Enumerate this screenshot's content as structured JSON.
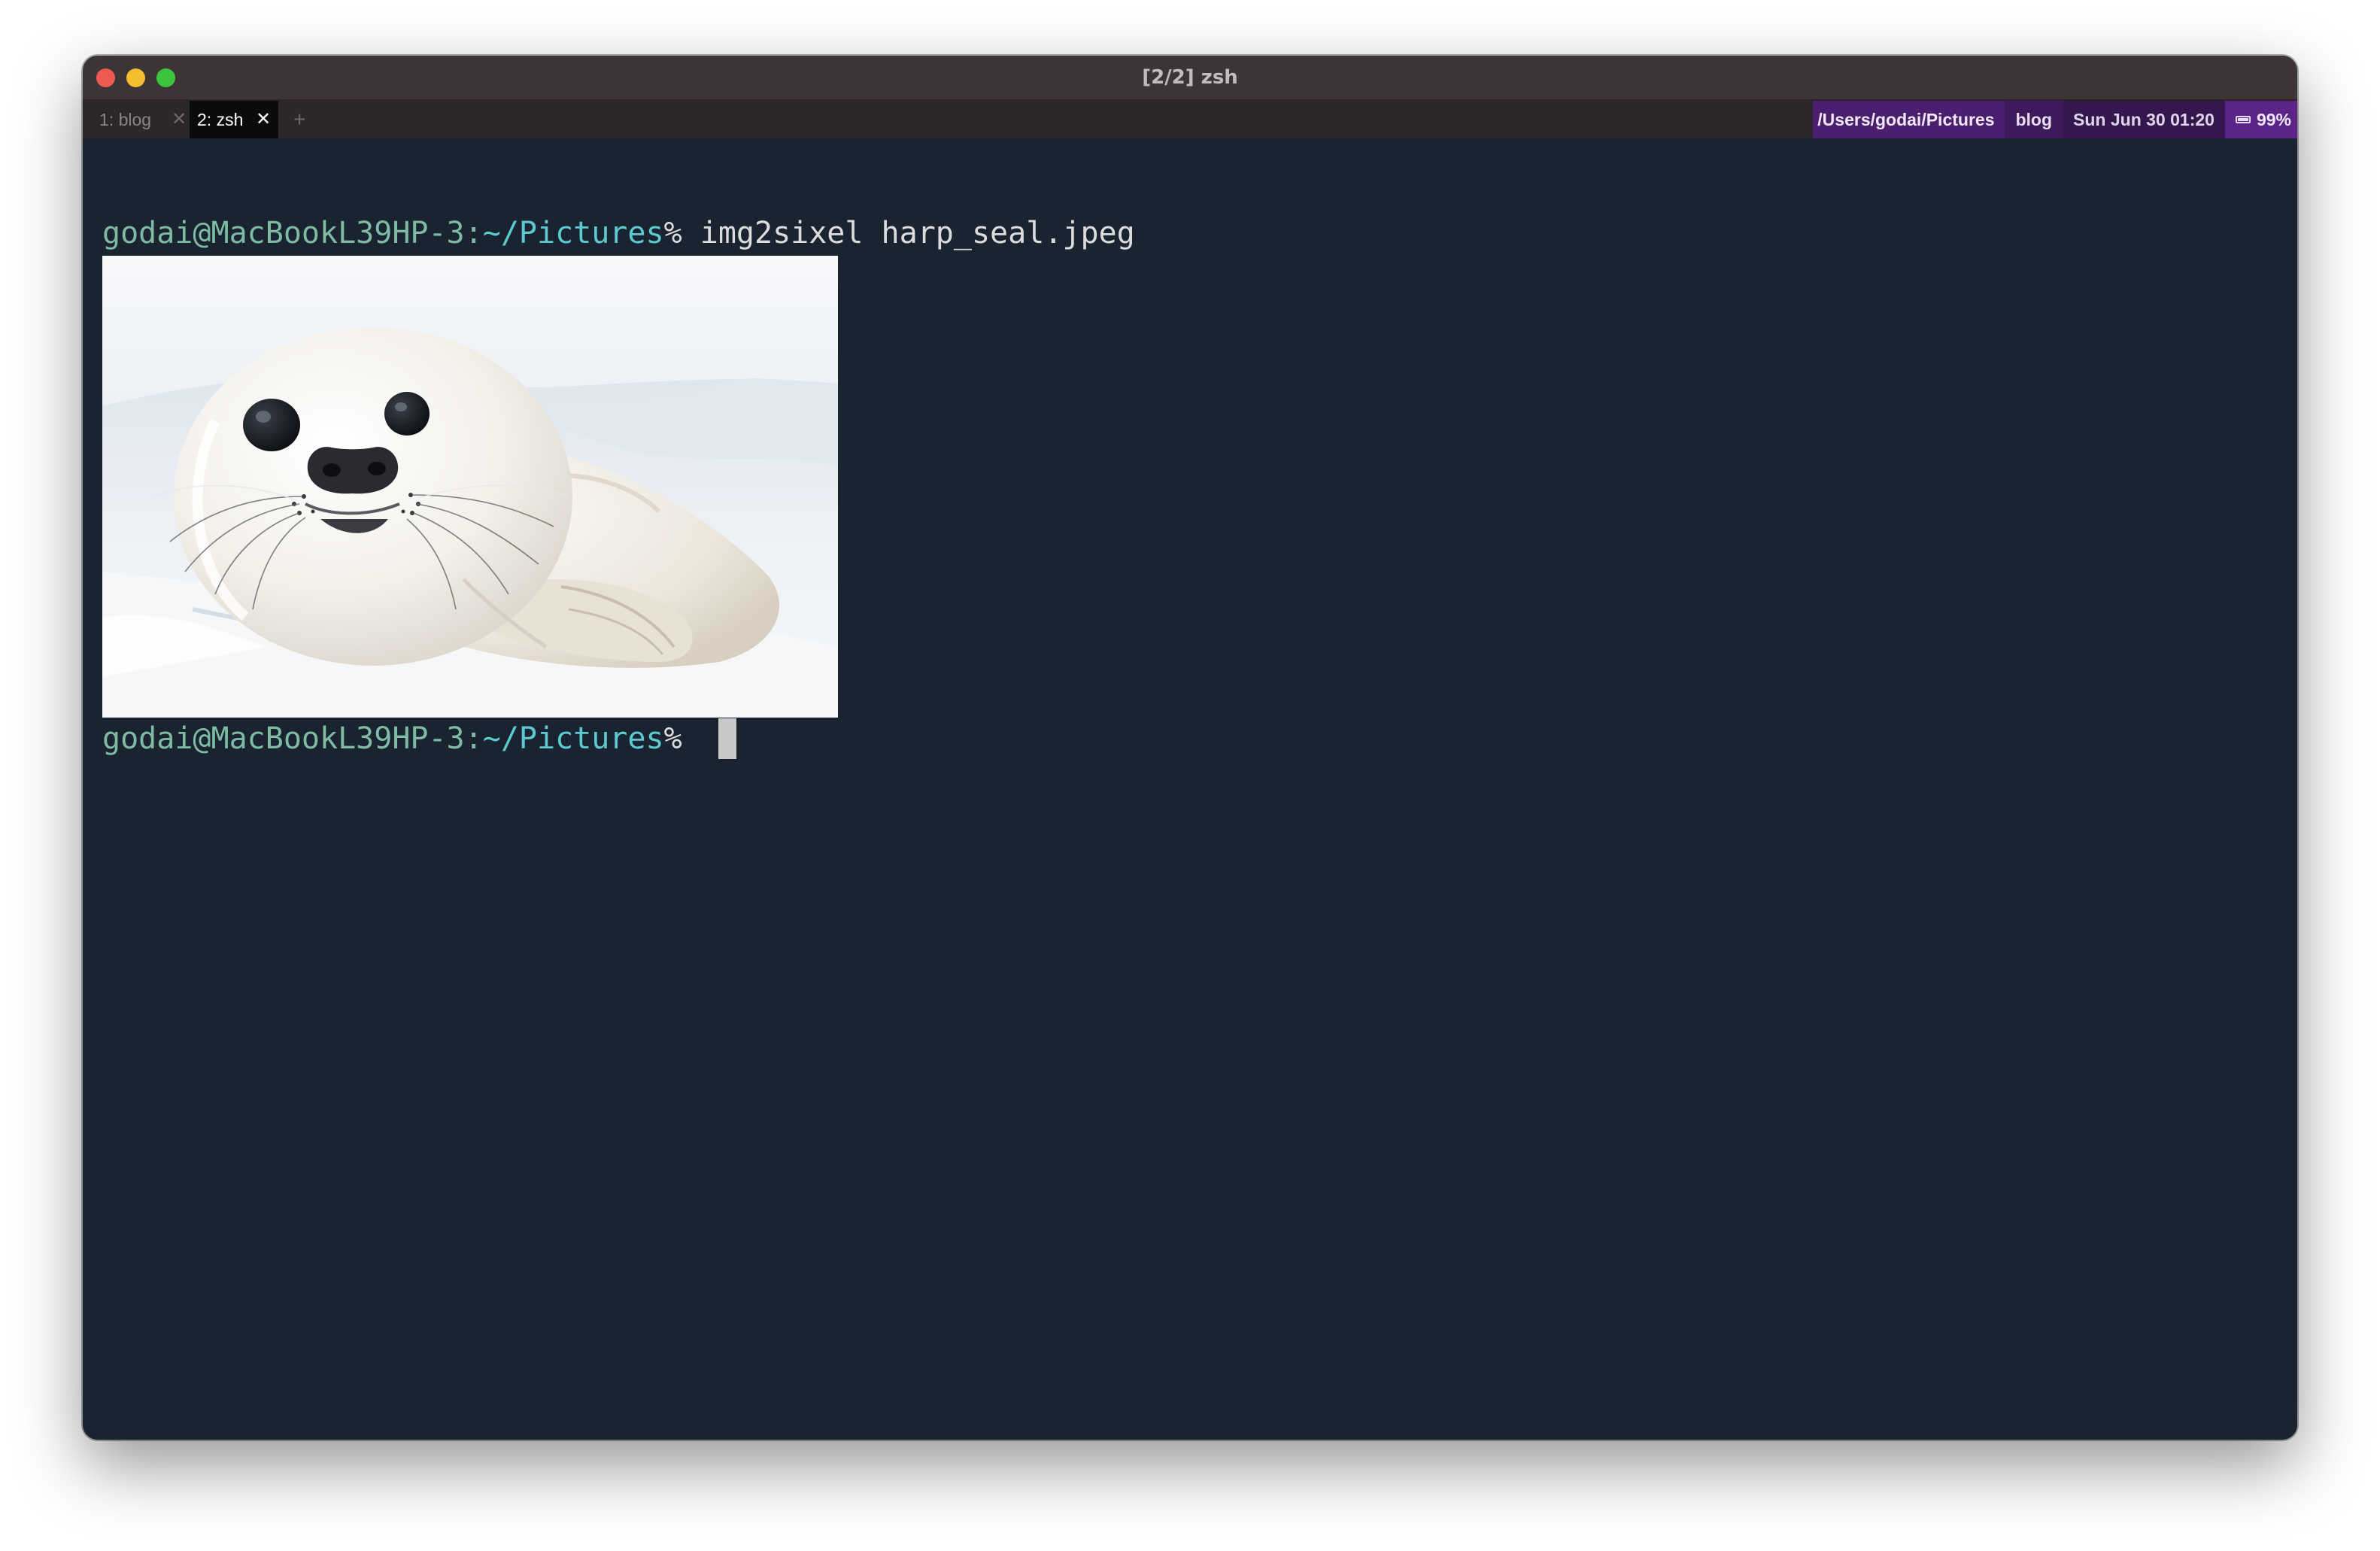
{
  "window": {
    "title": "[2/2] zsh"
  },
  "tabs": [
    {
      "label": "1: blog",
      "close": "✕"
    },
    {
      "label": "2: zsh",
      "close": "✕"
    }
  ],
  "new_tab": "+",
  "status_bar": {
    "path": "/Users/godai/Pictures",
    "session": "blog",
    "datetime": "Sun Jun 30 01:20",
    "battery": "99%"
  },
  "terminal": {
    "lines": [
      {
        "userhost": "godai@MacBookL39HP-3:",
        "cwd": "~/Pictures",
        "sigil": "% ",
        "command": "img2sixel harp_seal.jpeg"
      },
      {
        "userhost": "godai@MacBookL39HP-3:",
        "cwd": "~/Pictures",
        "sigil": "% ",
        "command": ""
      }
    ]
  },
  "icons": {
    "close": "close-icon",
    "new_tab": "plus-icon",
    "battery": "battery-icon"
  },
  "colors": {
    "terminal_bg": "#1a2330",
    "prompt_userhost": "#7dbba3",
    "prompt_cwd": "#5ccad0",
    "status_path_bg": "#4a1f70",
    "status_batt_bg": "#5a2488"
  }
}
